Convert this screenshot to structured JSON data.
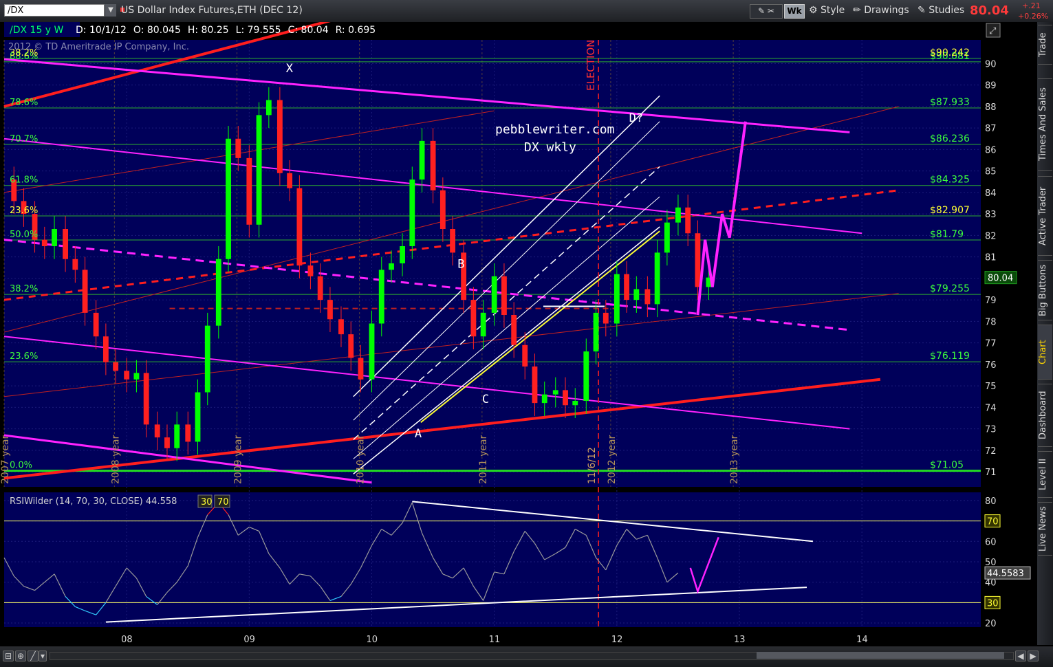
{
  "toolbar": {
    "symbol": "/DX",
    "instrument": "US Dollar Index Futures,ETH (DEC 12)",
    "wk_button": "Wk",
    "style_label": "Style",
    "drawings_label": "Drawings",
    "studies_label": "Studies",
    "last_price": "80.04",
    "net_change": "+.21",
    "pct_change": "+0.26%"
  },
  "sidebar": {
    "tabs": [
      "Trade",
      "Times And Sales",
      "Active Trader",
      "Big Buttons",
      "Chart",
      "Dashboard",
      "Level II",
      "Live News"
    ],
    "active_tab": "Chart"
  },
  "colors": {
    "background": "#00005a",
    "grid": "#1c1c7a",
    "fib_line": "#2eae2e",
    "fib_text": "#3cff3c",
    "magenta": "#ff22ff",
    "red_trend": "#ff1e1e",
    "white": "#ffffff",
    "yellow": "#ffff33",
    "candle_up": "#00ff00",
    "candle_down": "#ff2020",
    "rsi_line": "#9a9a9a",
    "rsi_overbought": "#ff2020",
    "rsi_oversold": "#33ccff"
  },
  "chart_data": [
    {
      "type": "candlestick",
      "header": {
        "symbol": "/DX",
        "period": "15 y W",
        "date": "D: 10/1/12",
        "open": "O: 80.045",
        "high": "H: 80.25",
        "low": "L: 79.555",
        "close": "C: 80.04",
        "range": "R: 0.695"
      },
      "watermark": "2012 © TD Ameritrade IP Company, Inc.",
      "ylim": [
        70.3,
        91.1
      ],
      "xlim": [
        2007.0,
        2014.97
      ],
      "yticks": [
        71,
        72,
        73,
        74,
        75,
        76,
        77,
        78,
        79,
        80,
        81,
        82,
        83,
        84,
        85,
        86,
        87,
        88,
        89,
        90
      ],
      "xticks": [
        {
          "label": "08",
          "x": 2008.0
        },
        {
          "label": "09",
          "x": 2009.0
        },
        {
          "label": "10",
          "x": 2010.0
        },
        {
          "label": "11",
          "x": 2011.0
        },
        {
          "label": "12",
          "x": 2012.0
        },
        {
          "label": "13",
          "x": 2013.0
        },
        {
          "label": "14",
          "x": 2014.0
        }
      ],
      "year_markers": [
        {
          "label": "2007 year",
          "x": 2007.0
        },
        {
          "label": "2008 year",
          "x": 2007.9
        },
        {
          "label": "2009 year",
          "x": 2008.9
        },
        {
          "label": "2010 year",
          "x": 2009.9
        },
        {
          "label": "2011 year",
          "x": 2010.9
        },
        {
          "label": "2012 year",
          "x": 2011.95
        },
        {
          "label": "2013 year",
          "x": 2012.95
        }
      ],
      "fib_levels": [
        {
          "label": "0.0%",
          "value": 71.05,
          "price": "$71.05"
        },
        {
          "label": "23.6%",
          "value": 76.119,
          "price": "$76.119"
        },
        {
          "label": "38.2%",
          "value": 79.255,
          "price": "$79.255"
        },
        {
          "label": "50.0%",
          "value": 81.79,
          "price": "$81.79"
        },
        {
          "label": "23.6%",
          "value": 82.907,
          "price": "$82.907",
          "highlight": true
        },
        {
          "label": "61.8%",
          "value": 84.325,
          "price": "$84.325"
        },
        {
          "label": "70.7%",
          "value": 86.236,
          "price": "$86.236"
        },
        {
          "label": "78.6%",
          "value": 87.933,
          "price": "$87.933"
        },
        {
          "label": "88.6%",
          "value": 90.081,
          "price": "$90.081"
        },
        {
          "label": "38.2%",
          "value": 90.242,
          "price": "$90.242",
          "highlight": true
        }
      ],
      "current_price_label": "80.04",
      "current_price": 80.04,
      "annotations": [
        {
          "text": "X",
          "x": 2009.3,
          "y": 89.6
        },
        {
          "text": "B",
          "x": 2010.7,
          "y": 80.5
        },
        {
          "text": "C",
          "x": 2010.9,
          "y": 74.2
        },
        {
          "text": "A",
          "x": 2010.35,
          "y": 72.6
        },
        {
          "text": "D?",
          "x": 2012.1,
          "y": 87.3
        }
      ],
      "title_overlay": [
        "pebblewriter.com",
        "DX wkly"
      ],
      "election_label": "ELECTION",
      "election_date_label": "11/6/12",
      "election_x": 2011.85,
      "price_series": [
        [
          2007.0,
          84.6
        ],
        [
          2007.08,
          83.6
        ],
        [
          2007.16,
          83.0
        ],
        [
          2007.25,
          81.8
        ],
        [
          2007.33,
          81.5
        ],
        [
          2007.41,
          82.3
        ],
        [
          2007.5,
          80.9
        ],
        [
          2007.58,
          80.4
        ],
        [
          2007.66,
          78.4
        ],
        [
          2007.75,
          77.3
        ],
        [
          2007.83,
          76.1
        ],
        [
          2007.91,
          75.7
        ],
        [
          2008.0,
          75.3
        ],
        [
          2008.08,
          75.6
        ],
        [
          2008.16,
          73.2
        ],
        [
          2008.25,
          72.6
        ],
        [
          2008.33,
          72.1
        ],
        [
          2008.41,
          73.2
        ],
        [
          2008.5,
          72.4
        ],
        [
          2008.58,
          74.7
        ],
        [
          2008.66,
          77.8
        ],
        [
          2008.75,
          80.9
        ],
        [
          2008.83,
          86.5
        ],
        [
          2008.91,
          85.6
        ],
        [
          2009.0,
          82.5
        ],
        [
          2009.08,
          87.6
        ],
        [
          2009.16,
          88.3
        ],
        [
          2009.25,
          84.9
        ],
        [
          2009.33,
          84.2
        ],
        [
          2009.41,
          80.6
        ],
        [
          2009.5,
          80.1
        ],
        [
          2009.58,
          79.0
        ],
        [
          2009.66,
          78.1
        ],
        [
          2009.75,
          77.4
        ],
        [
          2009.83,
          76.3
        ],
        [
          2009.91,
          75.3
        ],
        [
          2010.0,
          77.9
        ],
        [
          2010.08,
          80.4
        ],
        [
          2010.16,
          80.7
        ],
        [
          2010.25,
          81.5
        ],
        [
          2010.33,
          84.6
        ],
        [
          2010.41,
          86.4
        ],
        [
          2010.5,
          84.1
        ],
        [
          2010.58,
          82.3
        ],
        [
          2010.66,
          81.2
        ],
        [
          2010.75,
          79.0
        ],
        [
          2010.83,
          77.3
        ],
        [
          2010.91,
          78.4
        ],
        [
          2011.0,
          80.1
        ],
        [
          2011.08,
          78.3
        ],
        [
          2011.16,
          76.9
        ],
        [
          2011.25,
          75.9
        ],
        [
          2011.33,
          74.2
        ],
        [
          2011.41,
          74.6
        ],
        [
          2011.5,
          74.8
        ],
        [
          2011.58,
          74.1
        ],
        [
          2011.66,
          74.3
        ],
        [
          2011.75,
          76.6
        ],
        [
          2011.83,
          78.4
        ],
        [
          2011.91,
          77.9
        ],
        [
          2012.0,
          80.2
        ],
        [
          2012.08,
          79.0
        ],
        [
          2012.16,
          79.5
        ],
        [
          2012.25,
          78.8
        ],
        [
          2012.33,
          81.2
        ],
        [
          2012.41,
          82.6
        ],
        [
          2012.5,
          83.3
        ],
        [
          2012.58,
          82.1
        ],
        [
          2012.66,
          79.6
        ],
        [
          2012.75,
          80.04
        ]
      ]
    },
    {
      "type": "line",
      "title": "RSIWilder (14, 70, 30, CLOSE)",
      "value_label": "44.558",
      "levels_label": [
        "30",
        "70"
      ],
      "current_value": 44.5583,
      "current_label": "44.5583",
      "ylim": [
        18,
        84
      ],
      "yticks": [
        20,
        30,
        40,
        50,
        60,
        70,
        80
      ],
      "overbought": 70,
      "oversold": 30,
      "series": [
        {
          "values": [
            [
              2007.0,
              52
            ],
            [
              2007.08,
              43
            ],
            [
              2007.16,
              38
            ],
            [
              2007.25,
              36
            ],
            [
              2007.33,
              40
            ],
            [
              2007.41,
              44
            ],
            [
              2007.5,
              33
            ],
            [
              2007.58,
              28
            ],
            [
              2007.66,
              26
            ],
            [
              2007.75,
              24
            ],
            [
              2007.83,
              30
            ],
            [
              2007.91,
              38
            ],
            [
              2008.0,
              47
            ],
            [
              2008.08,
              42
            ],
            [
              2008.16,
              33
            ],
            [
              2008.25,
              29
            ],
            [
              2008.33,
              35
            ],
            [
              2008.41,
              40
            ],
            [
              2008.5,
              48
            ],
            [
              2008.58,
              62
            ],
            [
              2008.66,
              73
            ],
            [
              2008.75,
              79
            ],
            [
              2008.83,
              73
            ],
            [
              2008.91,
              63
            ],
            [
              2009.0,
              67
            ],
            [
              2009.08,
              65
            ],
            [
              2009.16,
              54
            ],
            [
              2009.25,
              47
            ],
            [
              2009.33,
              39
            ],
            [
              2009.41,
              44
            ],
            [
              2009.5,
              43
            ],
            [
              2009.58,
              38
            ],
            [
              2009.66,
              31
            ],
            [
              2009.75,
              33
            ],
            [
              2009.83,
              39
            ],
            [
              2009.91,
              47
            ],
            [
              2010.0,
              58
            ],
            [
              2010.08,
              66
            ],
            [
              2010.16,
              63
            ],
            [
              2010.25,
              69
            ],
            [
              2010.33,
              79
            ],
            [
              2010.41,
              64
            ],
            [
              2010.5,
              52
            ],
            [
              2010.58,
              44
            ],
            [
              2010.66,
              42
            ],
            [
              2010.75,
              47
            ],
            [
              2010.83,
              38
            ],
            [
              2010.91,
              31
            ],
            [
              2011.0,
              45
            ],
            [
              2011.08,
              44
            ],
            [
              2011.16,
              55
            ],
            [
              2011.25,
              65
            ],
            [
              2011.33,
              59
            ],
            [
              2011.41,
              51
            ],
            [
              2011.5,
              54
            ],
            [
              2011.58,
              57
            ],
            [
              2011.66,
              66
            ],
            [
              2011.75,
              63
            ],
            [
              2011.83,
              52
            ],
            [
              2011.91,
              46
            ],
            [
              2012.0,
              58
            ],
            [
              2012.08,
              66
            ],
            [
              2012.16,
              61
            ],
            [
              2012.25,
              63
            ],
            [
              2012.33,
              52
            ],
            [
              2012.41,
              40
            ],
            [
              2012.5,
              44.5583
            ]
          ]
        }
      ]
    }
  ]
}
